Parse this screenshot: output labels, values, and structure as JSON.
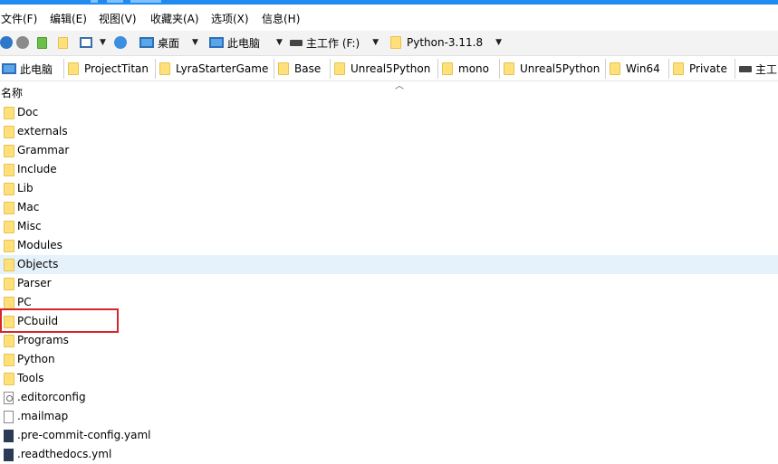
{
  "menu": [
    "文件(F)",
    "编辑(E)",
    "视图(V)",
    "收藏夹(A)",
    "选项(X)",
    "信息(H)"
  ],
  "toolbar": {
    "desktop": "桌面",
    "this_pc": "此电脑",
    "drive": "主工作 (F:)",
    "current_folder": "Python-3.11.8"
  },
  "bookmarks": [
    "此电脑",
    "ProjectTitan",
    "LyraStarterGame",
    "Base",
    "Unreal5Python",
    "mono",
    "Unreal5Python",
    "Win64",
    "Private",
    "主工"
  ],
  "column_header": {
    "name": "名称"
  },
  "files": [
    {
      "name": "Doc",
      "icon": "folder-icon"
    },
    {
      "name": "externals",
      "icon": "folder-icon"
    },
    {
      "name": "Grammar",
      "icon": "folder-icon"
    },
    {
      "name": "Include",
      "icon": "folder-icon"
    },
    {
      "name": "Lib",
      "icon": "folder-icon"
    },
    {
      "name": "Mac",
      "icon": "folder-icon"
    },
    {
      "name": "Misc",
      "icon": "folder-icon"
    },
    {
      "name": "Modules",
      "icon": "folder-icon"
    },
    {
      "name": "Objects",
      "icon": "folder-icon"
    },
    {
      "name": "Parser",
      "icon": "folder-icon"
    },
    {
      "name": "PC",
      "icon": "folder-icon"
    },
    {
      "name": "PCbuild",
      "icon": "folder-icon"
    },
    {
      "name": "Programs",
      "icon": "folder-icon"
    },
    {
      "name": "Python",
      "icon": "folder-icon"
    },
    {
      "name": "Tools",
      "icon": "folder-icon"
    },
    {
      "name": ".editorconfig",
      "icon": "config-file-icon"
    },
    {
      "name": ".mailmap",
      "icon": "file-icon"
    },
    {
      "name": ".pre-commit-config.yaml",
      "icon": "yaml-file-icon"
    },
    {
      "name": ".readthedocs.yml",
      "icon": "yaml-file-icon"
    }
  ],
  "hovered_item": "Objects",
  "highlighted_item": "PCbuild",
  "colors": {
    "highlight_border": "#d7262b",
    "hover_row": "#e5f1fb",
    "folder": "#ffe07a"
  }
}
